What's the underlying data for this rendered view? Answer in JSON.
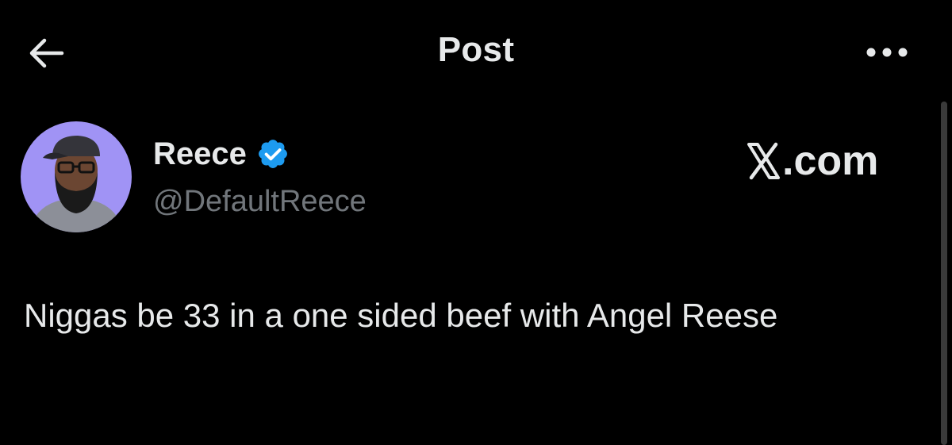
{
  "header": {
    "title": "Post",
    "back_icon": "arrow-left-icon",
    "more_icon": "more-horizontal-icon"
  },
  "author": {
    "display_name": "Reece",
    "handle": "@DefaultReece",
    "verified": true,
    "verified_icon": "verified-badge-icon",
    "avatar_background": "#a093f5"
  },
  "watermark": {
    "logo_icon": "x-logo-icon",
    "text": ".com"
  },
  "post": {
    "text": "Niggas be 33 in a one sided beef with Angel Reese"
  },
  "colors": {
    "background": "#000000",
    "primary_text": "#e7e9ea",
    "secondary_text": "#71767b",
    "verified_blue": "#1d9bf0"
  }
}
